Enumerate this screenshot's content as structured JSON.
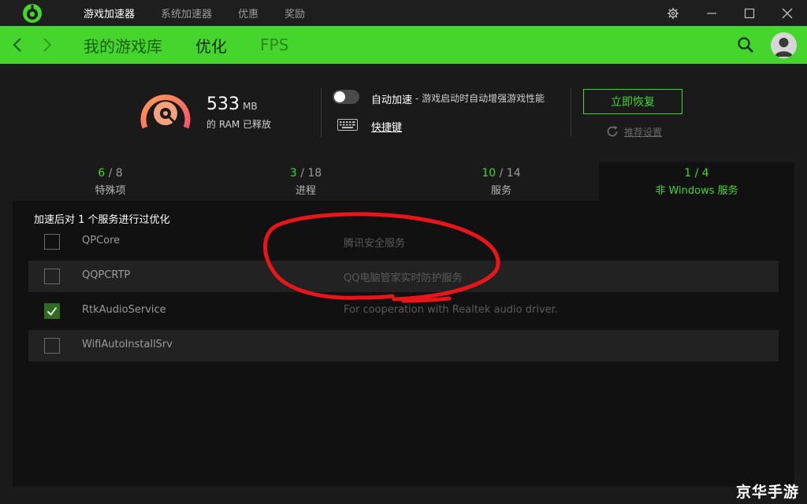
{
  "titlebar": {
    "nav": [
      "游戏加速器",
      "系统加速器",
      "优惠",
      "奖励"
    ]
  },
  "subnav": {
    "tabs": [
      "我的游戏库",
      "优化",
      "FPS"
    ]
  },
  "stats": {
    "ram_value": "533",
    "ram_unit": "MB",
    "ram_label": "的 RAM 已释放"
  },
  "auto_boost": {
    "label": "自动加速",
    "description": "- 游戏启动时自动增强游戏性能",
    "enabled": false
  },
  "shortcut": {
    "label": "快捷键"
  },
  "actions": {
    "restore_label": "立即恢复",
    "reset_label": "推荐设置"
  },
  "tabs": [
    {
      "done": "6",
      "total": "/ 8",
      "label": "特殊项"
    },
    {
      "done": "3",
      "total": "/ 18",
      "label": "进程"
    },
    {
      "done": "10",
      "total": "/ 14",
      "label": "服务"
    },
    {
      "done": "1",
      "total": "/ 4",
      "label": "非 Windows 服务"
    }
  ],
  "list": {
    "title": "加速后对 1 个服务进行过优化",
    "items": [
      {
        "name": "QPCore",
        "description": "腾讯安全服务",
        "checked": false
      },
      {
        "name": "QQPCRTP",
        "description": "QQ电脑管家实时防护服务",
        "checked": false
      },
      {
        "name": "RtkAudioService",
        "description": "For cooperation with Realtek audio driver.",
        "checked": true
      },
      {
        "name": "WifiAutoInstallSrv",
        "description": "",
        "checked": false
      }
    ]
  },
  "watermark": "京华手游",
  "colors": {
    "accent": "#44d62c",
    "annotation": "#e8151b"
  },
  "icons": {
    "logo": "razer-cortex-logo-icon",
    "settings": "gear-icon",
    "search": "search-icon",
    "avatar": "user-avatar-icon",
    "keyboard": "keyboard-icon",
    "reset": "refresh-icon"
  }
}
